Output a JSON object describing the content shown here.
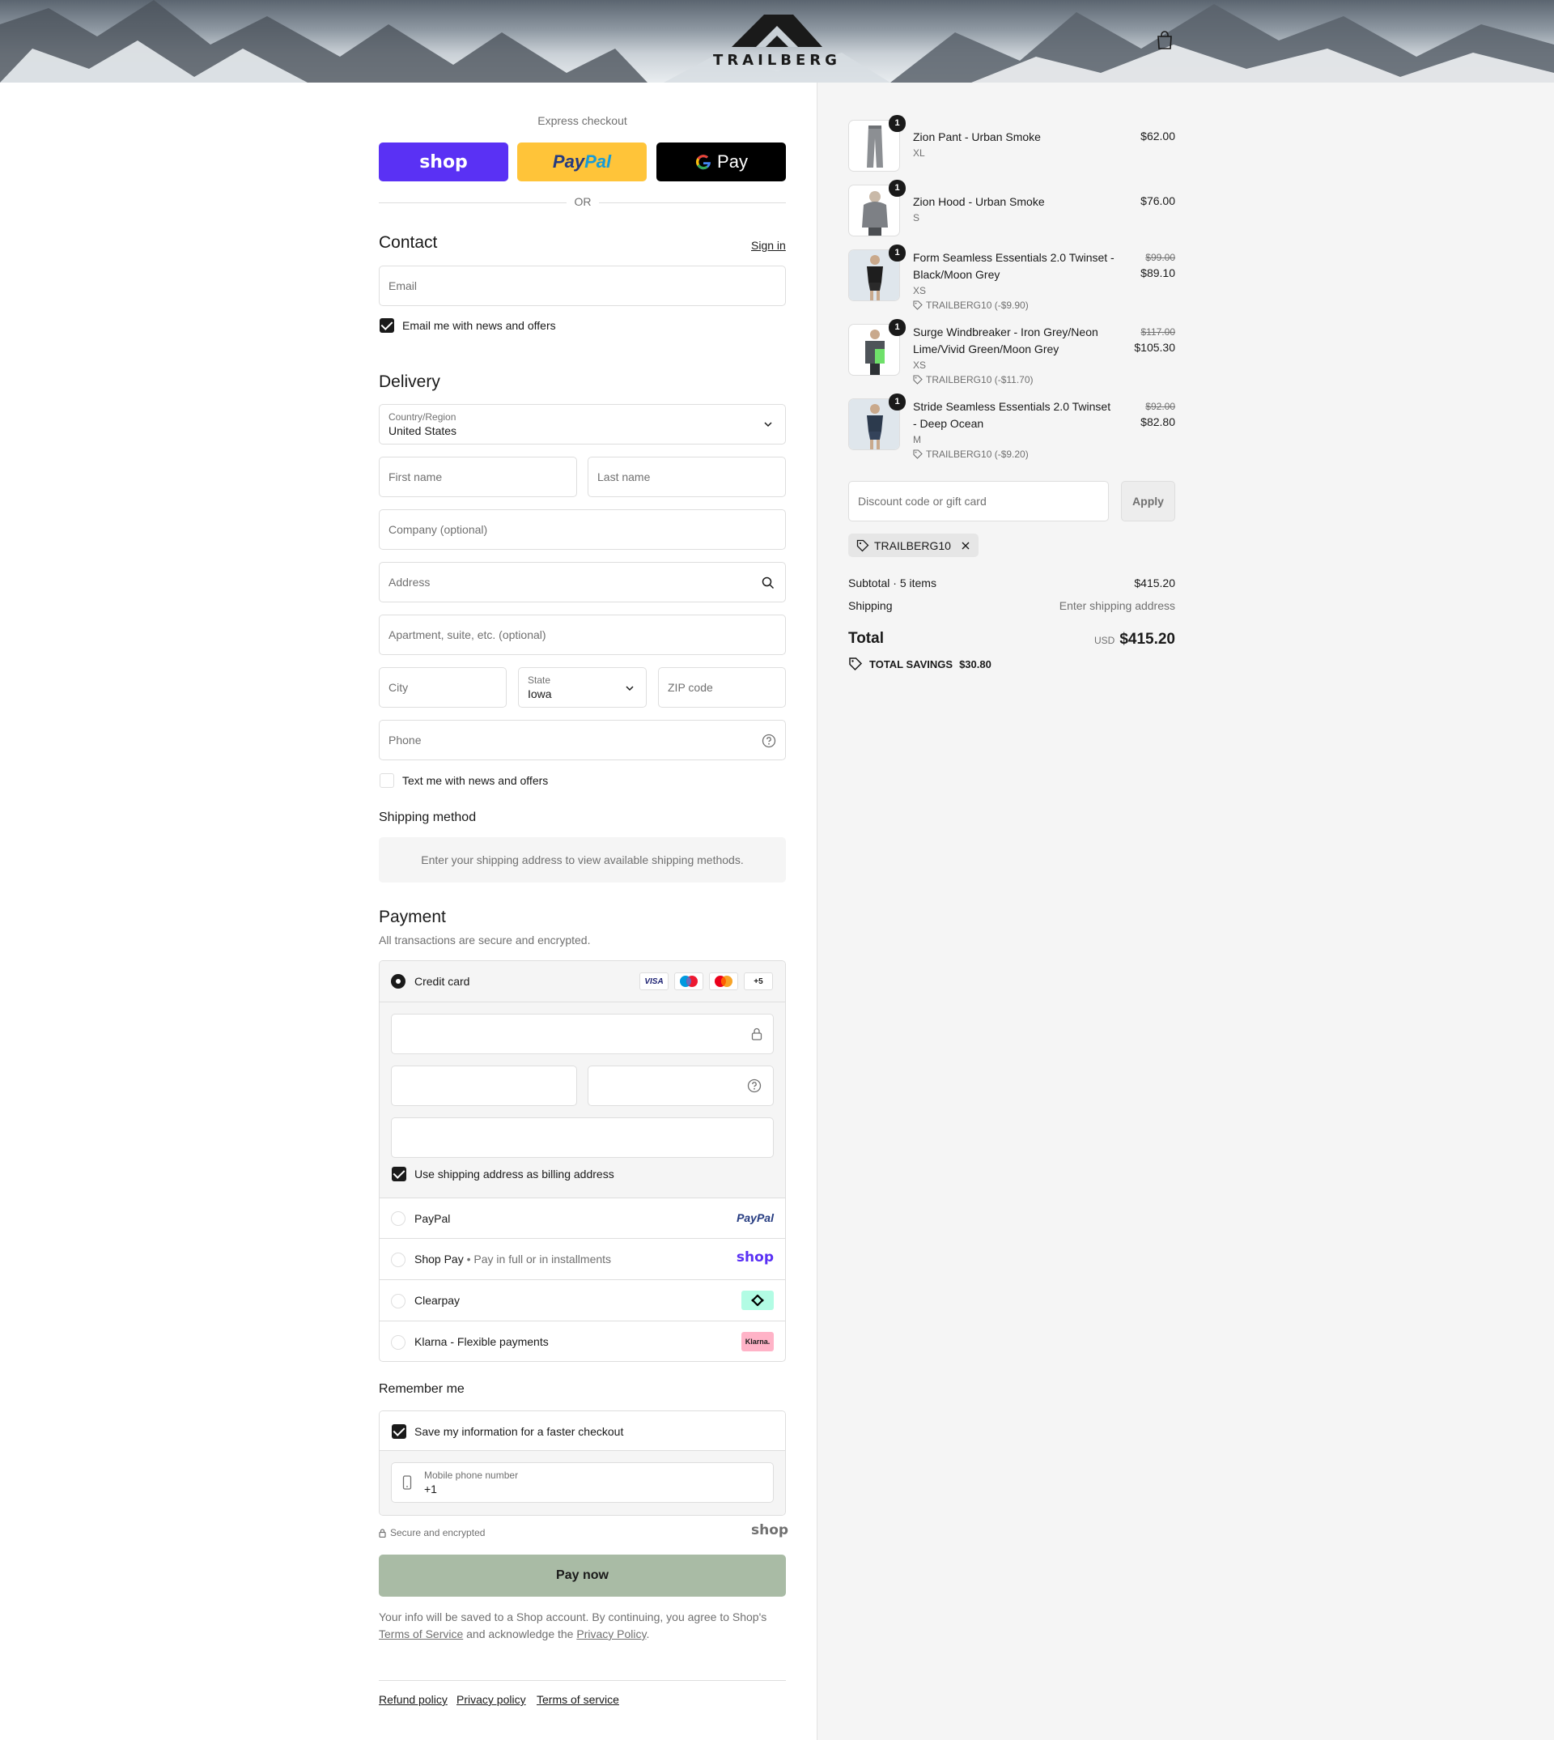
{
  "header": {
    "brand": "TRAILBERG",
    "cart_icon": "shopping-bag-icon"
  },
  "express": {
    "title": "Express checkout",
    "shop_label": "shop",
    "paypal_label_a": "Pay",
    "paypal_label_b": "Pal",
    "gpay_label": "Pay",
    "or_label": "OR",
    "colors": {
      "shop": "#5a31f4",
      "paypal": "#ffc439",
      "gpay": "#000000"
    }
  },
  "contact": {
    "heading": "Contact",
    "sign_in": "Sign in",
    "email_placeholder": "Email",
    "news_checkbox_label": "Email me with news and offers",
    "news_checked": true
  },
  "delivery": {
    "heading": "Delivery",
    "country_label": "Country/Region",
    "country_value": "United States",
    "first_name_ph": "First name",
    "last_name_ph": "Last name",
    "company_ph": "Company (optional)",
    "address_ph": "Address",
    "apartment_ph": "Apartment, suite, etc. (optional)",
    "city_ph": "City",
    "state_label": "State",
    "state_value": "Iowa",
    "zip_ph": "ZIP code",
    "phone_ph": "Phone",
    "text_checkbox_label": "Text me with news and offers",
    "text_checked": false
  },
  "shipping_method": {
    "heading": "Shipping method",
    "info": "Enter your shipping address to view available shipping methods."
  },
  "payment": {
    "heading": "Payment",
    "subtitle": "All transactions are secure and encrypted.",
    "credit_card_label": "Credit card",
    "card_brands": [
      "VISA",
      "maestro",
      "mastercard",
      "+5"
    ],
    "billing_checkbox_label": "Use shipping address as billing address",
    "billing_checked": true,
    "methods": [
      {
        "label": "PayPal",
        "logo": "PayPal"
      },
      {
        "label": "Shop Pay",
        "detail": "Pay in full or in installments",
        "logo": "shop"
      },
      {
        "label": "Clearpay",
        "logo": "clearpay-icon"
      },
      {
        "label": "Klarna - Flexible payments",
        "logo": "Klarna."
      }
    ]
  },
  "remember": {
    "heading": "Remember me",
    "save_label": "Save my information for a faster checkout",
    "save_checked": true,
    "mobile_label": "Mobile phone number",
    "mobile_value": "+1",
    "secure_label": "Secure and encrypted",
    "shop_logo": "shop"
  },
  "pay_now": "Pay now",
  "legal": {
    "text_a": "Your info will be saved to a Shop account. By continuing, you agree to Shop's",
    "terms_link": "Terms of Service",
    "text_b": "and acknowledge the",
    "privacy_link": "Privacy Policy",
    "text_c": "."
  },
  "footer": {
    "refund": "Refund policy",
    "privacy": "Privacy policy",
    "terms": "Terms of service"
  },
  "cart": {
    "items": [
      {
        "name": "Zion Pant - Urban Smoke",
        "variant": "XL",
        "qty": "1",
        "price": "$62.00"
      },
      {
        "name": "Zion Hood - Urban Smoke",
        "variant": "S",
        "qty": "1",
        "price": "$76.00"
      },
      {
        "name": "Form Seamless Essentials 2.0 Twinset - Black/Moon Grey",
        "variant": "XS",
        "qty": "1",
        "old_price": "$99.00",
        "price": "$89.10",
        "discount": "TRAILBERG10 (-$9.90)"
      },
      {
        "name": "Surge Windbreaker - Iron Grey/Neon Lime/Vivid Green/Moon Grey",
        "variant": "XS",
        "qty": "1",
        "old_price": "$117.00",
        "price": "$105.30",
        "discount": "TRAILBERG10 (-$11.70)"
      },
      {
        "name": "Stride Seamless Essentials 2.0 Twinset - Deep Ocean",
        "variant": "M",
        "qty": "1",
        "old_price": "$92.00",
        "price": "$82.80",
        "discount": "TRAILBERG10 (-$9.20)"
      }
    ],
    "discount_placeholder": "Discount code or gift card",
    "apply_label": "Apply",
    "applied_code": "TRAILBERG10",
    "subtotal_label": "Subtotal · 5 items",
    "subtotal_value": "$415.20",
    "shipping_label": "Shipping",
    "shipping_value": "Enter shipping address",
    "total_label": "Total",
    "currency": "USD",
    "total_value": "$415.20",
    "savings_label": "TOTAL SAVINGS",
    "savings_value": "$30.80"
  }
}
